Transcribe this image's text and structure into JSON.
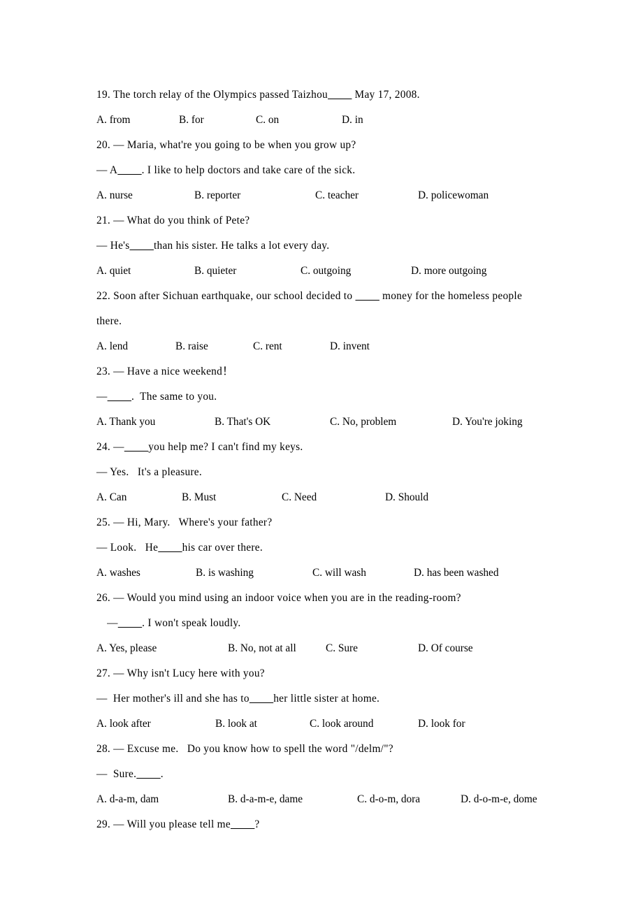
{
  "document": {
    "type": "english-exam-multiple-choice",
    "page_background": "#ffffff",
    "text_color": "#000000",
    "questions": [
      {
        "number": "19",
        "lines": [
          {
            "text": "19. The torch relay of the Olympics passed Taizhou_________ May 17, 2008."
          }
        ],
        "options": [
          {
            "label": "A. from",
            "col": 0
          },
          {
            "label": "B. for",
            "col": 1
          },
          {
            "label": "C. on",
            "col": 2
          },
          {
            "label": "D. in",
            "col": 3
          }
        ],
        "option_widths": [
          118,
          110,
          123,
          80
        ]
      },
      {
        "number": "20",
        "lines": [
          {
            "text": "20. — Maria, what're you going to be when you grow up?"
          },
          {
            "text": "— A_________. I like to help doctors and take care of the sick."
          }
        ],
        "options": [
          {
            "label": "A. nurse",
            "col": 0
          },
          {
            "label": "B. reporter",
            "col": 1
          },
          {
            "label": "C. teacher",
            "col": 2
          },
          {
            "label": "D. policewoman",
            "col": 3
          }
        ],
        "option_widths": [
          140,
          173,
          147,
          140
        ]
      },
      {
        "number": "21",
        "lines": [
          {
            "text": "21. — What do you think of Pete?"
          },
          {
            "text": "— He's_________than his sister. He talks a lot every day."
          }
        ],
        "options": [
          {
            "label": "A. quiet",
            "col": 0
          },
          {
            "label": "B. quieter",
            "col": 1
          },
          {
            "label": "C. outgoing",
            "col": 2
          },
          {
            "label": "D. more outgoing",
            "col": 3
          }
        ],
        "option_widths": [
          140,
          152,
          158,
          150
        ]
      },
      {
        "number": "22",
        "lines": [
          {
            "text": "22. Soon after Sichuan earthquake,   our school decided to _________ money for the homeless people there.",
            "wrap": true
          }
        ],
        "options": [
          {
            "label": "A. lend",
            "col": 0
          },
          {
            "label": "B. raise",
            "col": 1
          },
          {
            "label": "C. rent",
            "col": 2
          },
          {
            "label": "D. invent",
            "col": 3
          }
        ],
        "option_widths": [
          113,
          111,
          110,
          90
        ]
      },
      {
        "number": "23",
        "lines": [
          {
            "text": "23. — Have a nice weekend！"
          },
          {
            "text": "—_________.  The same to you."
          }
        ],
        "options": [
          {
            "label": "A. Thank you",
            "col": 0
          },
          {
            "label": "B. That's OK",
            "col": 1
          },
          {
            "label": "C. No, problem",
            "col": 2
          },
          {
            "label": "D. You're joking",
            "col": 3
          }
        ],
        "option_widths": [
          169,
          165,
          175,
          150
        ]
      },
      {
        "number": "24",
        "lines": [
          {
            "text": "24. —_________you help me? I can't find my keys."
          },
          {
            "text": "— Yes.   It's a pleasure."
          }
        ],
        "options": [
          {
            "label": "A. Can",
            "col": 0
          },
          {
            "label": "B. Must",
            "col": 1
          },
          {
            "label": "C. Need",
            "col": 2
          },
          {
            "label": "D. Should",
            "col": 3
          }
        ],
        "option_widths": [
          122,
          143,
          148,
          100
        ]
      },
      {
        "number": "25",
        "lines": [
          {
            "text": "25. — Hi, Mary.   Where's your father?"
          },
          {
            "text": "— Look.   He_________his car over there."
          }
        ],
        "options": [
          {
            "label": "A. washes",
            "col": 0
          },
          {
            "label": "B. is washing",
            "col": 1
          },
          {
            "label": "C. will wash",
            "col": 2
          },
          {
            "label": "D. has been washed",
            "col": 3
          }
        ],
        "option_widths": [
          142,
          167,
          145,
          170
        ]
      },
      {
        "number": "26",
        "lines": [
          {
            "text": "26. — Would you mind using an indoor voice when you are in the reading-room?"
          },
          {
            "text": " —_________. I won't speak loudly.",
            "indent": true
          }
        ],
        "options": [
          {
            "label": "A. Yes, please",
            "col": 0
          },
          {
            "label": "B. No, not at all",
            "col": 1
          },
          {
            "label": "C. Sure",
            "col": 2
          },
          {
            "label": "D. Of course",
            "col": 3
          }
        ],
        "option_widths": [
          188,
          140,
          132,
          120
        ]
      },
      {
        "number": "27",
        "lines": [
          {
            "text": "27. — Why isn't Lucy here with you?"
          },
          {
            "text": "—  Her mother's ill and she has to_________her little sister at home."
          }
        ],
        "options": [
          {
            "label": "A. look after",
            "col": 0
          },
          {
            "label": "B. look at",
            "col": 1
          },
          {
            "label": "C. look around",
            "col": 2
          },
          {
            "label": "D. look for",
            "col": 3
          }
        ],
        "option_widths": [
          170,
          135,
          155,
          120
        ]
      },
      {
        "number": "28",
        "lines": [
          {
            "text": "28. — Excuse me.   Do you know how to spell the word \"/delm/\"?"
          },
          {
            "text": "—  Sure._________."
          }
        ],
        "options": [
          {
            "label": "A. d-a-m, dam",
            "col": 0
          },
          {
            "label": "B. d-a-m-e, dame",
            "col": 1
          },
          {
            "label": "C. d-o-m, dora",
            "col": 2
          },
          {
            "label": "D. d-o-m-e, dome",
            "col": 3
          }
        ],
        "option_widths": [
          188,
          185,
          148,
          150
        ]
      },
      {
        "number": "29",
        "lines": [
          {
            "text": "29. — Will you please tell me_________?"
          }
        ],
        "options": [],
        "option_widths": []
      }
    ]
  }
}
